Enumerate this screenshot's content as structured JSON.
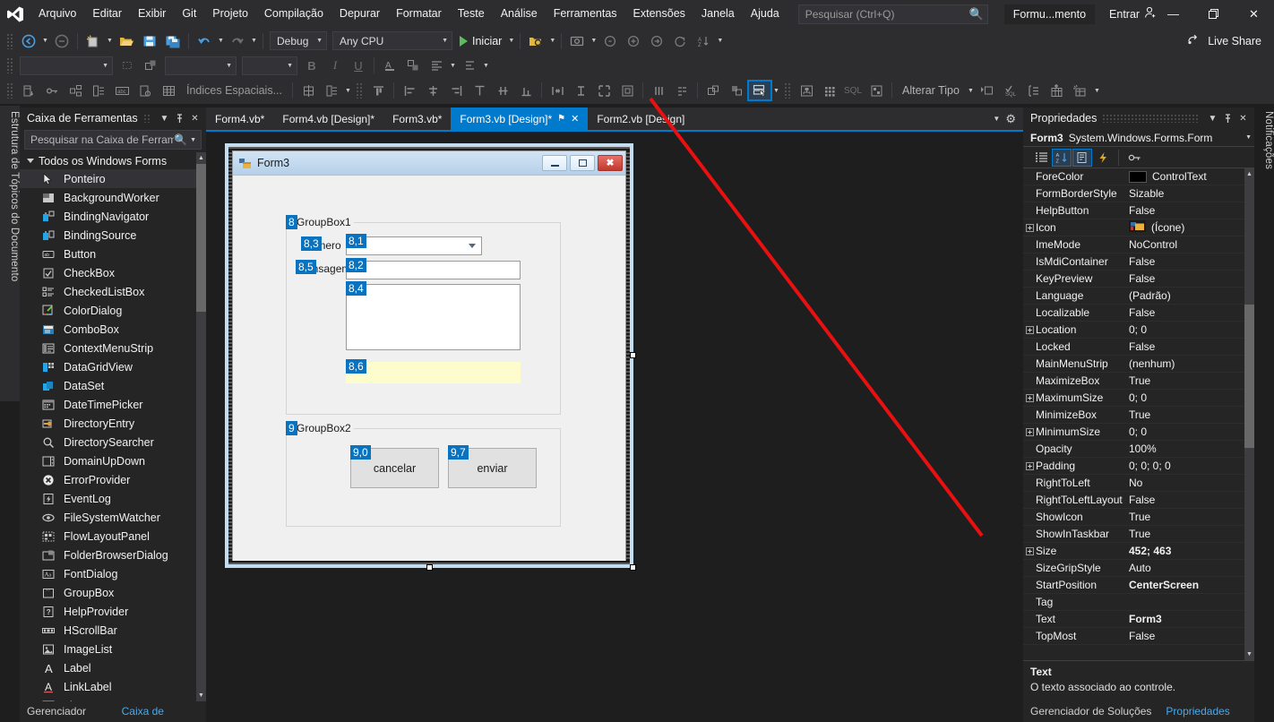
{
  "app": {
    "title_chip": "Formu...mento",
    "signin": "Entrar",
    "live_share": "Live Share"
  },
  "menu": {
    "items": [
      "Arquivo",
      "Editar",
      "Exibir",
      "Git",
      "Projeto",
      "Compilação",
      "Depurar",
      "Formatar",
      "Teste",
      "Análise",
      "Ferramentas",
      "Extensões",
      "Janela",
      "Ajuda"
    ]
  },
  "search": {
    "placeholder": "Pesquisar (Ctrl+Q)",
    "value": ""
  },
  "window_controls": {
    "minimize": "—",
    "restore": "❐",
    "close": "✕"
  },
  "toolbar1": {
    "config": "Debug",
    "platform": "Any CPU",
    "start": "Iniciar"
  },
  "toolbar2": {
    "font_combo": "",
    "size_combo": "",
    "style_combo": "",
    "bold": "B",
    "italic": "I",
    "underline": "U",
    "fontcolor": "A"
  },
  "toolbar3": {
    "spatial_indexes": "Índices Espaciais...",
    "change_type": "Alterar Tipo",
    "sql": "SQL",
    "tab_order_highlighted": true
  },
  "left_dock_tab": "Estrutura de Tópicos do Documento",
  "right_dock_tab": "Notificações",
  "toolbox": {
    "title": "Caixa de Ferramentas",
    "search_placeholder": "Pesquisar na Caixa de Ferramen",
    "group": "Todos os Windows Forms",
    "items": [
      {
        "label": "Ponteiro",
        "icon": "pointer-icon",
        "selected": true
      },
      {
        "label": "BackgroundWorker",
        "icon": "backgroundworker-icon",
        "selected": false
      },
      {
        "label": "BindingNavigator",
        "icon": "bindingnavigator-icon",
        "selected": false
      },
      {
        "label": "BindingSource",
        "icon": "bindingsource-icon",
        "selected": false
      },
      {
        "label": "Button",
        "icon": "button-icon",
        "selected": false
      },
      {
        "label": "CheckBox",
        "icon": "checkbox-icon",
        "selected": false
      },
      {
        "label": "CheckedListBox",
        "icon": "checkedlistbox-icon",
        "selected": false
      },
      {
        "label": "ColorDialog",
        "icon": "colordialog-icon",
        "selected": false
      },
      {
        "label": "ComboBox",
        "icon": "combobox-icon",
        "selected": false
      },
      {
        "label": "ContextMenuStrip",
        "icon": "contextmenustrip-icon",
        "selected": false
      },
      {
        "label": "DataGridView",
        "icon": "datagridview-icon",
        "selected": false
      },
      {
        "label": "DataSet",
        "icon": "dataset-icon",
        "selected": false
      },
      {
        "label": "DateTimePicker",
        "icon": "datetimepicker-icon",
        "selected": false
      },
      {
        "label": "DirectoryEntry",
        "icon": "directoryentry-icon",
        "selected": false
      },
      {
        "label": "DirectorySearcher",
        "icon": "directorysearcher-icon",
        "selected": false
      },
      {
        "label": "DomainUpDown",
        "icon": "domainupdown-icon",
        "selected": false
      },
      {
        "label": "ErrorProvider",
        "icon": "errorprovider-icon",
        "selected": false
      },
      {
        "label": "EventLog",
        "icon": "eventlog-icon",
        "selected": false
      },
      {
        "label": "FileSystemWatcher",
        "icon": "filesystemwatcher-icon",
        "selected": false
      },
      {
        "label": "FlowLayoutPanel",
        "icon": "flowlayoutpanel-icon",
        "selected": false
      },
      {
        "label": "FolderBrowserDialog",
        "icon": "folderbrowserdialog-icon",
        "selected": false
      },
      {
        "label": "FontDialog",
        "icon": "fontdialog-icon",
        "selected": false
      },
      {
        "label": "GroupBox",
        "icon": "groupbox-icon",
        "selected": false
      },
      {
        "label": "HelpProvider",
        "icon": "helpprovider-icon",
        "selected": false
      },
      {
        "label": "HScrollBar",
        "icon": "hscrollbar-icon",
        "selected": false
      },
      {
        "label": "ImageList",
        "icon": "imagelist-icon",
        "selected": false
      },
      {
        "label": "Label",
        "icon": "label-icon",
        "selected": false
      },
      {
        "label": "LinkLabel",
        "icon": "linklabel-icon",
        "selected": false
      },
      {
        "label": "ListBox",
        "icon": "listbox-icon",
        "selected": false
      }
    ],
    "footer_tabs": [
      {
        "label": "Gerenciador de...",
        "active": false
      },
      {
        "label": "Caixa de Ferra...",
        "active": true
      }
    ]
  },
  "editor_tabs": [
    {
      "label": "Form4.vb*",
      "active": false
    },
    {
      "label": "Form4.vb [Design]*",
      "active": false
    },
    {
      "label": "Form3.vb*",
      "active": false
    },
    {
      "label": "Form3.vb [Design]*",
      "active": true,
      "pin": "⚑",
      "close": "✕"
    },
    {
      "label": "Form2.vb [Design]",
      "active": false
    }
  ],
  "designer": {
    "form_caption": "Form3",
    "groupbox1": "GroupBox1",
    "groupbox2": "GroupBox2",
    "label_numero": "Número",
    "label_mensagem": "Mensagem",
    "button_cancel": "cancelar",
    "button_send": "enviar",
    "tab_order_badges": [
      {
        "text": "8",
        "target": "groupbox1"
      },
      {
        "text": "8,1",
        "target": "combobox1"
      },
      {
        "text": "8,2",
        "target": "textbox-numero"
      },
      {
        "text": "8,3",
        "target": "label-numero"
      },
      {
        "text": "8,4",
        "target": "textbox-mensagem"
      },
      {
        "text": "8,5",
        "target": "label-mensagem"
      },
      {
        "text": "8,6",
        "target": "textbox-yellow"
      },
      {
        "text": "9",
        "target": "groupbox2"
      },
      {
        "text": "9,0",
        "target": "button-cancelar"
      },
      {
        "text": "9,7",
        "target": "button-enviar"
      }
    ]
  },
  "properties": {
    "title": "Propriedades",
    "object_name": "Form3",
    "object_type": "System.Windows.Forms.Form",
    "toolbar_buttons": [
      "categorized-icon",
      "alphabetical-icon",
      "properties-page-icon",
      "events-icon",
      "property-pages-icon"
    ],
    "rows": [
      {
        "name": "ForeColor",
        "value": "ControlText",
        "expandable": false,
        "swatch": "#000000",
        "bold": false
      },
      {
        "name": "FormBorderStyle",
        "value": "Sizable",
        "expandable": false,
        "bold": false
      },
      {
        "name": "HelpButton",
        "value": "False",
        "expandable": false,
        "bold": false
      },
      {
        "name": "Icon",
        "value": "(Ícone)",
        "expandable": true,
        "icon": true,
        "bold": false
      },
      {
        "name": "ImeMode",
        "value": "NoControl",
        "expandable": false,
        "bold": false
      },
      {
        "name": "IsMdiContainer",
        "value": "False",
        "expandable": false,
        "bold": false
      },
      {
        "name": "KeyPreview",
        "value": "False",
        "expandable": false,
        "bold": false
      },
      {
        "name": "Language",
        "value": "(Padrão)",
        "expandable": false,
        "bold": false
      },
      {
        "name": "Localizable",
        "value": "False",
        "expandable": false,
        "bold": false
      },
      {
        "name": "Location",
        "value": "0; 0",
        "expandable": true,
        "bold": false
      },
      {
        "name": "Locked",
        "value": "False",
        "expandable": false,
        "bold": false
      },
      {
        "name": "MainMenuStrip",
        "value": "(nenhum)",
        "expandable": false,
        "bold": false
      },
      {
        "name": "MaximizeBox",
        "value": "True",
        "expandable": false,
        "bold": false
      },
      {
        "name": "MaximumSize",
        "value": "0; 0",
        "expandable": true,
        "bold": false
      },
      {
        "name": "MinimizeBox",
        "value": "True",
        "expandable": false,
        "bold": false
      },
      {
        "name": "MinimumSize",
        "value": "0; 0",
        "expandable": true,
        "bold": false
      },
      {
        "name": "Opacity",
        "value": "100%",
        "expandable": false,
        "bold": false
      },
      {
        "name": "Padding",
        "value": "0; 0; 0; 0",
        "expandable": true,
        "bold": false
      },
      {
        "name": "RightToLeft",
        "value": "No",
        "expandable": false,
        "bold": false
      },
      {
        "name": "RightToLeftLayout",
        "value": "False",
        "expandable": false,
        "bold": false
      },
      {
        "name": "ShowIcon",
        "value": "True",
        "expandable": false,
        "bold": false
      },
      {
        "name": "ShowInTaskbar",
        "value": "True",
        "expandable": false,
        "bold": false
      },
      {
        "name": "Size",
        "value": "452; 463",
        "expandable": true,
        "bold": true
      },
      {
        "name": "SizeGripStyle",
        "value": "Auto",
        "expandable": false,
        "bold": false
      },
      {
        "name": "StartPosition",
        "value": "CenterScreen",
        "expandable": false,
        "bold": true
      },
      {
        "name": "Tag",
        "value": "",
        "expandable": false,
        "bold": false
      },
      {
        "name": "Text",
        "value": "Form3",
        "expandable": false,
        "bold": true
      },
      {
        "name": "TopMost",
        "value": "False",
        "expandable": false,
        "bold": false
      }
    ],
    "description_title": "Text",
    "description_body": "O texto associado ao controle.",
    "footer_tabs": [
      {
        "label": "Gerenciador de Soluções",
        "active": false
      },
      {
        "label": "Propriedades",
        "active": true
      }
    ]
  },
  "colors": {
    "accent": "#007acc",
    "badge": "#0a73c0",
    "annotation": "#e81010",
    "chrome": "#2d2d30",
    "panel": "#252526"
  }
}
